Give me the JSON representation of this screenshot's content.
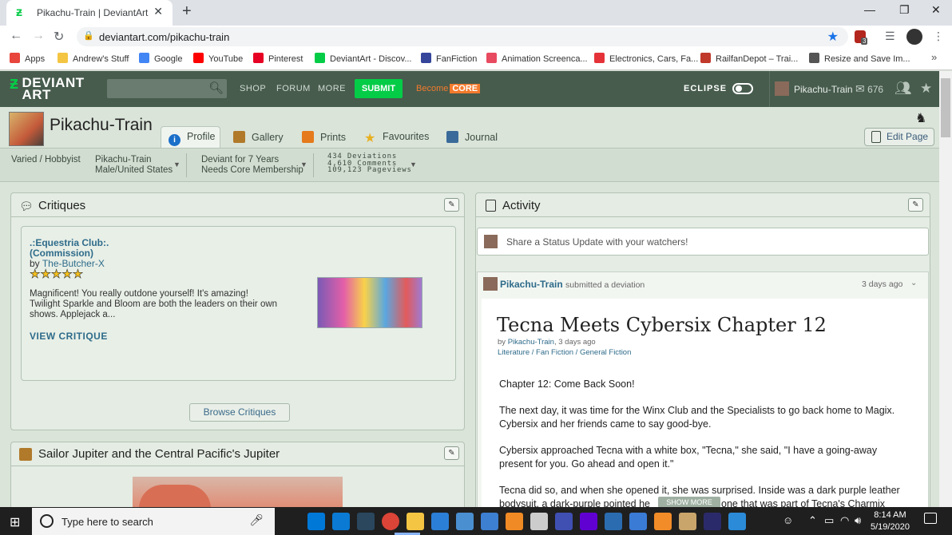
{
  "browser": {
    "tab_title": "Pikachu-Train | DeviantArt",
    "url": "deviantart.com/pikachu-train",
    "bookmarks": [
      {
        "label": "Apps",
        "color": "#e8453c"
      },
      {
        "label": "Andrew's Stuff",
        "color": "#f4c542"
      },
      {
        "label": "Google",
        "color": "#4285f4"
      },
      {
        "label": "YouTube",
        "color": "#ff0000"
      },
      {
        "label": "Pinterest",
        "color": "#e60023"
      },
      {
        "label": "DeviantArt - Discov...",
        "color": "#05cc47"
      },
      {
        "label": "FanFiction",
        "color": "#34459a"
      },
      {
        "label": "Animation Screenca...",
        "color": "#e84a5f"
      },
      {
        "label": "Electronics, Cars, Fa...",
        "color": "#e53238"
      },
      {
        "label": "RailfanDepot – Trai...",
        "color": "#c0392b"
      },
      {
        "label": "Resize and Save Im...",
        "color": "#555555"
      }
    ],
    "extension_badge": "3"
  },
  "da_header": {
    "logo_line1": "DEVIANT",
    "logo_line2": "ART",
    "nav": [
      "SHOP",
      "FORUM",
      "MORE"
    ],
    "submit": "SUBMIT",
    "become": "Become",
    "core": "CORE",
    "eclipse": "ECLIPSE",
    "username": "Pikachu-Train",
    "notes_count": "676"
  },
  "profile": {
    "name": "Pikachu-Train",
    "tabs": [
      {
        "label": "Profile",
        "color": "#1a6fc9"
      },
      {
        "label": "Gallery",
        "color": "#b07a2a"
      },
      {
        "label": "Prints",
        "color": "#e57a1c"
      },
      {
        "label": "Favourites",
        "color": "#f4c542"
      },
      {
        "label": "Journal",
        "color": "#3a6a9a"
      }
    ],
    "edit_page": "Edit Page",
    "stats": {
      "type": "Varied / Hobbyist",
      "user": "Pikachu-Train",
      "location": "Male/United States",
      "deviant_for": "Deviant for 7 Years",
      "membership": "Needs Core Membership",
      "deviations": "434 Deviations",
      "comments": "4,610 Comments",
      "pageviews": "109,123 Pageviews"
    }
  },
  "critiques": {
    "heading": "Critiques",
    "title_line1": ".:Equestria Club:.",
    "title_line2": "(Commission)",
    "by": "by",
    "author": "The-Butcher-X",
    "stars": 5,
    "text_line1": "Magnificent! You really outdone yourself! It's amazing!",
    "text_line2": "Twilight Sparkle and Bloom are both the leaders on their own",
    "text_line3": "shows. Applejack a...",
    "view": "VIEW CRITIQUE",
    "browse": "Browse Critiques"
  },
  "featured": {
    "heading": "Sailor Jupiter and the Central Pacific's Jupiter"
  },
  "activity": {
    "heading": "Activity",
    "status_placeholder": "Share a Status Update with your watchers!",
    "user": "Pikachu-Train",
    "action": "submitted a deviation",
    "time": "3 days ago",
    "dev_title": "Tecna Meets Cybersix Chapter 12",
    "byline_by": "by",
    "byline_user": "Pikachu-Train",
    "byline_time": ", 3 days ago",
    "category": "Literature / Fan Fiction / General Fiction",
    "para1": "Chapter 12: Come Back Soon!",
    "para2a": "The next day, it was time for the Winx Club and the Specialists to go back home to Magix.",
    "para2b": "Cybersix and her friends came to say good-bye.",
    "para3a": "Cybersix approached Tecna with a white box, \"Tecna,\" she said, \"I have a going-away",
    "para3b": "present for you. Go ahead and open it.\"",
    "para4a": "Tecna did so, and when she opened it, she was surprised. Inside was a dark purple leather",
    "para4b_start": "bodysuit, a dark-purple pointed he",
    "para4b_end": "one that was part of Tecna's Charmix",
    "show_more": "SHOW MORE"
  },
  "taskbar": {
    "search_placeholder": "Type here to search",
    "time": "8:14 AM",
    "date": "5/19/2020"
  }
}
